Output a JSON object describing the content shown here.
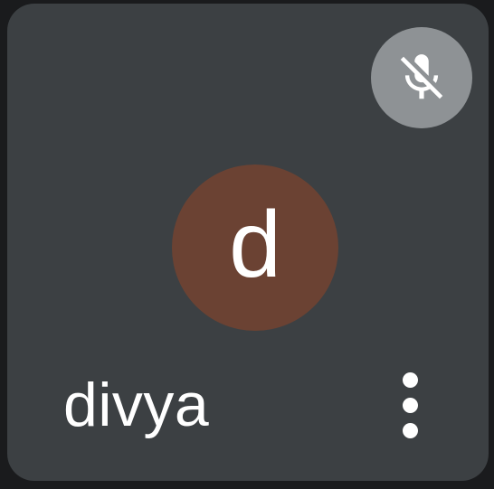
{
  "participant": {
    "name": "divya",
    "avatar_initial": "d",
    "avatar_color": "#6b4233",
    "mic_status": "muted",
    "mic_icon": "mic-off-icon",
    "menu_icon": "more-vert-icon"
  },
  "colors": {
    "tile_background": "#3c4043",
    "mic_badge": "#8e9295",
    "text": "#ffffff"
  }
}
